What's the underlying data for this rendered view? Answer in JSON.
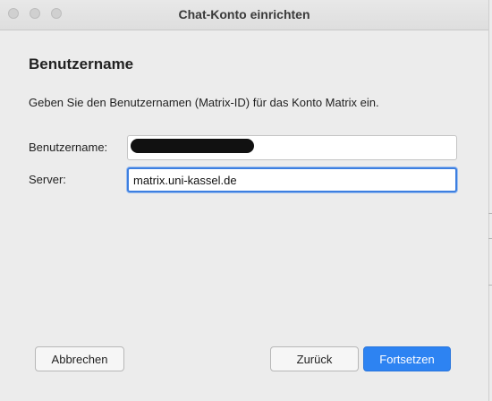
{
  "window": {
    "title": "Chat-Konto einrichten"
  },
  "content": {
    "heading": "Benutzername",
    "description": "Geben Sie den Benutzernamen (Matrix-ID) für das Konto Matrix ein."
  },
  "form": {
    "username_label": "Benutzername:",
    "username_value": "",
    "server_label": "Server:",
    "server_value": "matrix.uni-kassel.de"
  },
  "buttons": {
    "cancel": "Abbrechen",
    "back": "Zurück",
    "next": "Fortsetzen"
  },
  "colors": {
    "accent": "#2d83f2",
    "focus_ring": "#3d7fe0"
  }
}
